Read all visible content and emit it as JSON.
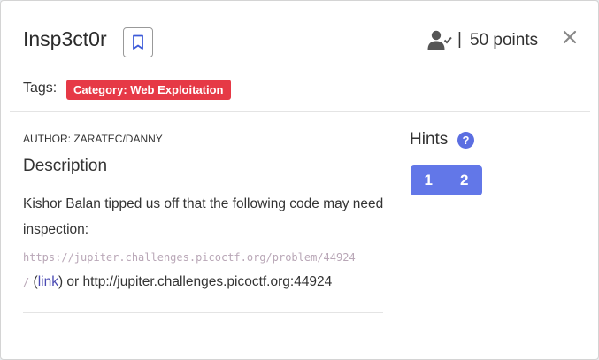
{
  "challenge": {
    "title": "Insp3ct0r",
    "points_label": "50 points",
    "separator": "|"
  },
  "tags": {
    "label": "Tags:",
    "category": "Category: Web Exploitation"
  },
  "author": "AUTHOR: ZARATEC/DANNY",
  "description": {
    "heading": "Description",
    "text": "Kishor Balan tipped us off that the following code may need inspection:",
    "code_url": "https://jupiter.challenges.picoctf.org/problem/44924",
    "code_url_tail": "/",
    "link_open": " (",
    "link_label": "link",
    "link_close": ") or http://jupiter.challenges.picoctf.org:44924"
  },
  "hints": {
    "heading": "Hints",
    "help_symbol": "?",
    "buttons": [
      "1",
      "2"
    ]
  },
  "icons": [
    "bookmark-icon",
    "user-check-icon",
    "close-icon",
    "question-icon"
  ],
  "colors": {
    "tag_bg": "#e63946",
    "hint_bg": "#6277e8",
    "link": "#4a4ab3",
    "bookmark_accent": "#3d5bd9"
  }
}
